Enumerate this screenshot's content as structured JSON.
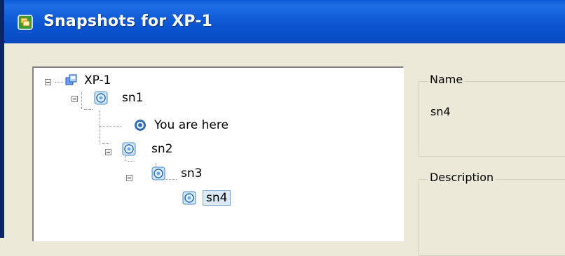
{
  "window": {
    "title": "Snapshots for XP-1"
  },
  "tree": {
    "nodes": [
      {
        "label": "XP-1",
        "icon": "vm-icon"
      },
      {
        "label": "sn1",
        "icon": "snapshot-icon"
      },
      {
        "label": "You are here",
        "icon": "current-state-icon"
      },
      {
        "label": "sn2",
        "icon": "snapshot-icon"
      },
      {
        "label": "sn3",
        "icon": "snapshot-icon"
      },
      {
        "label": "sn4",
        "icon": "snapshot-icon",
        "selected": true
      }
    ]
  },
  "details": {
    "name_label": "Name",
    "name_value": "sn4",
    "description_label": "Description"
  },
  "colors": {
    "titlebar": "#0c56d2",
    "dialog_bg": "#ece9d8",
    "selection": "#dce9f7"
  }
}
